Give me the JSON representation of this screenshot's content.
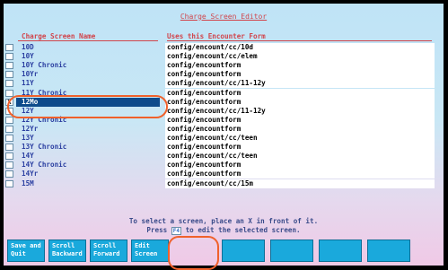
{
  "title": "Charge Screen Editor",
  "columns": {
    "name": "Charge Screen Name",
    "form": "Uses this Encounter Form"
  },
  "rows": [
    {
      "name": "10D",
      "form": "config/encount/cc/10d",
      "mark": ""
    },
    {
      "name": "10Y",
      "form": "config/encount/cc/elem",
      "mark": ""
    },
    {
      "name": "10Y Chronic",
      "form": "config/encountform",
      "mark": ""
    },
    {
      "name": "10Yr",
      "form": "config/encountform",
      "mark": ""
    },
    {
      "name": "11Y",
      "form": "config/encount/cc/11-12y",
      "mark": ""
    },
    {
      "name": "11Y Chronic",
      "form": "config/encountform",
      "mark": ""
    },
    {
      "name": "12Mo",
      "form": "config/encountform",
      "mark": "X"
    },
    {
      "name": "12Y",
      "form": "config/encount/cc/11-12y",
      "mark": ""
    },
    {
      "name": "12Y Chronic",
      "form": "config/encountform",
      "mark": ""
    },
    {
      "name": "12Yr",
      "form": "config/encountform",
      "mark": ""
    },
    {
      "name": "13Y",
      "form": "config/encount/cc/teen",
      "mark": ""
    },
    {
      "name": "13Y Chronic",
      "form": "config/encountform",
      "mark": ""
    },
    {
      "name": "14Y",
      "form": "config/encount/cc/teen",
      "mark": ""
    },
    {
      "name": "14Y Chronic",
      "form": "config/encountform",
      "mark": ""
    },
    {
      "name": "14Yr",
      "form": "config/encountform",
      "mark": ""
    },
    {
      "name": "15M",
      "form": "config/encount/cc/15m",
      "mark": ""
    }
  ],
  "selected_index": 6,
  "instructions": {
    "line1": "To select a screen, place an X in front of it.",
    "line2_pre": "Press",
    "line2_key": "F4",
    "line2_post": "to edit the selected screen."
  },
  "buttons": [
    {
      "line1": "Save and",
      "line2": "Quit"
    },
    {
      "line1": "Scroll",
      "line2": "Backward"
    },
    {
      "line1": "Scroll",
      "line2": "Forward"
    },
    {
      "line1": "Edit",
      "line2": "Screen"
    },
    {
      "line1": "",
      "line2": ""
    },
    {
      "line1": "",
      "line2": ""
    },
    {
      "line1": "",
      "line2": ""
    },
    {
      "line1": "",
      "line2": ""
    }
  ]
}
